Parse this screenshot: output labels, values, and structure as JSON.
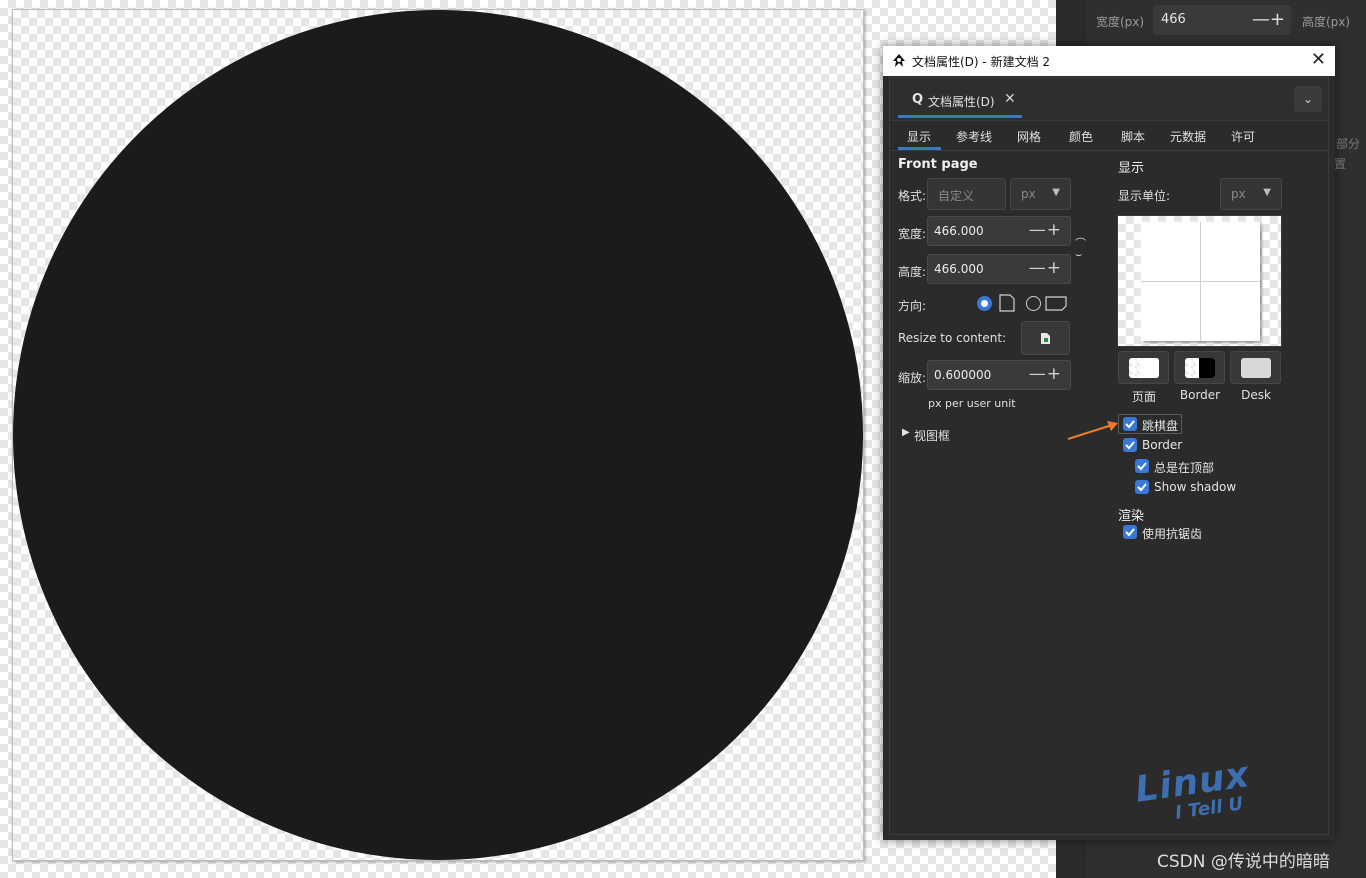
{
  "right_panel": {
    "width_label": "宽度(px)",
    "width_value": "466",
    "height_label": "高度(px)",
    "partial_1": "部分",
    "partial_2": "置"
  },
  "dialog": {
    "title": "文档属性(D) - 新建文档 2",
    "dock_tab_label": "文档属性(D)",
    "tabs": [
      "显示",
      "参考线",
      "网格",
      "颜色",
      "脚本",
      "元数据",
      "许可"
    ],
    "left": {
      "section_title": "Front page",
      "format_label": "格式:",
      "format_value": "自定义",
      "format_unit": "px",
      "width_label": "宽度:",
      "width_value": "466.000",
      "height_label": "高度:",
      "height_value": "466.000",
      "orientation_label": "方向:",
      "resize_label": "Resize to content:",
      "scale_label": "缩放:",
      "scale_value": "0.600000",
      "scale_hint": "px per user unit",
      "viewbox_label": "视图框"
    },
    "right": {
      "section_title": "显示",
      "units_label": "显示单位:",
      "units_value": "px",
      "swatch_labels": [
        "页面",
        "Border",
        "Desk"
      ],
      "checkerboard_label": "跳棋盘",
      "border_label": "Border",
      "always_on_top_label": "总是在顶部",
      "show_shadow_label": "Show shadow",
      "render_title": "渲染",
      "antialias_label": "使用抗锯齿"
    }
  },
  "watermark": {
    "big": "Linux",
    "small": "I Tell U"
  },
  "credit": "CSDN @传说中的暗暗",
  "colors": {
    "accent": "#3a78c4",
    "checkbox": "#3a78d8",
    "circle": "#1b1b1b",
    "arrow": "#f07a2a"
  }
}
